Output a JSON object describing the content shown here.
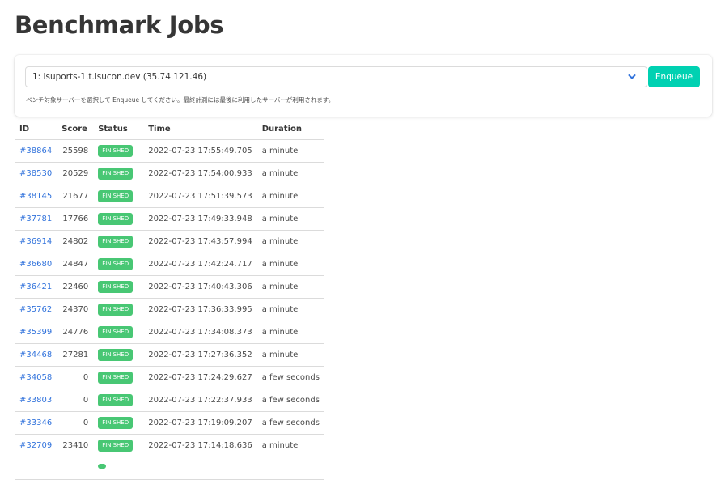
{
  "page": {
    "title": "Benchmark Jobs"
  },
  "enqueue": {
    "selected_server": "1: isuports-1.t.isucon.dev (35.74.121.46)",
    "button_label": "Enqueue",
    "help_text": "ベンチ対象サーバーを選択して Enqueue してください。最終計測には最後に利用したサーバーが利用されます。"
  },
  "table": {
    "headers": {
      "id": "ID",
      "score": "Score",
      "status": "Status",
      "time": "Time",
      "duration": "Duration"
    },
    "rows": [
      {
        "id": "#38864",
        "score": "25598",
        "status": "FINISHED",
        "time": "2022-07-23 17:55:49.705",
        "duration": "a minute"
      },
      {
        "id": "#38530",
        "score": "20529",
        "status": "FINISHED",
        "time": "2022-07-23 17:54:00.933",
        "duration": "a minute"
      },
      {
        "id": "#38145",
        "score": "21677",
        "status": "FINISHED",
        "time": "2022-07-23 17:51:39.573",
        "duration": "a minute"
      },
      {
        "id": "#37781",
        "score": "17766",
        "status": "FINISHED",
        "time": "2022-07-23 17:49:33.948",
        "duration": "a minute"
      },
      {
        "id": "#36914",
        "score": "24802",
        "status": "FINISHED",
        "time": "2022-07-23 17:43:57.994",
        "duration": "a minute"
      },
      {
        "id": "#36680",
        "score": "24847",
        "status": "FINISHED",
        "time": "2022-07-23 17:42:24.717",
        "duration": "a minute"
      },
      {
        "id": "#36421",
        "score": "22460",
        "status": "FINISHED",
        "time": "2022-07-23 17:40:43.306",
        "duration": "a minute"
      },
      {
        "id": "#35762",
        "score": "24370",
        "status": "FINISHED",
        "time": "2022-07-23 17:36:33.995",
        "duration": "a minute"
      },
      {
        "id": "#35399",
        "score": "24776",
        "status": "FINISHED",
        "time": "2022-07-23 17:34:08.373",
        "duration": "a minute"
      },
      {
        "id": "#34468",
        "score": "27281",
        "status": "FINISHED",
        "time": "2022-07-23 17:27:36.352",
        "duration": "a minute"
      },
      {
        "id": "#34058",
        "score": "0",
        "status": "FINISHED",
        "time": "2022-07-23 17:24:29.627",
        "duration": "a few seconds"
      },
      {
        "id": "#33803",
        "score": "0",
        "status": "FINISHED",
        "time": "2022-07-23 17:22:37.933",
        "duration": "a few seconds"
      },
      {
        "id": "#33346",
        "score": "0",
        "status": "FINISHED",
        "time": "2022-07-23 17:19:09.207",
        "duration": "a few seconds"
      },
      {
        "id": "#32709",
        "score": "23410",
        "status": "FINISHED",
        "time": "2022-07-23 17:14:18.636",
        "duration": "a minute"
      }
    ]
  },
  "icons": {
    "select_arrow": "chevron-down-icon"
  },
  "colors": {
    "primary": "#00d1b2",
    "link": "#3273dc",
    "status_finished": "#48c774"
  }
}
